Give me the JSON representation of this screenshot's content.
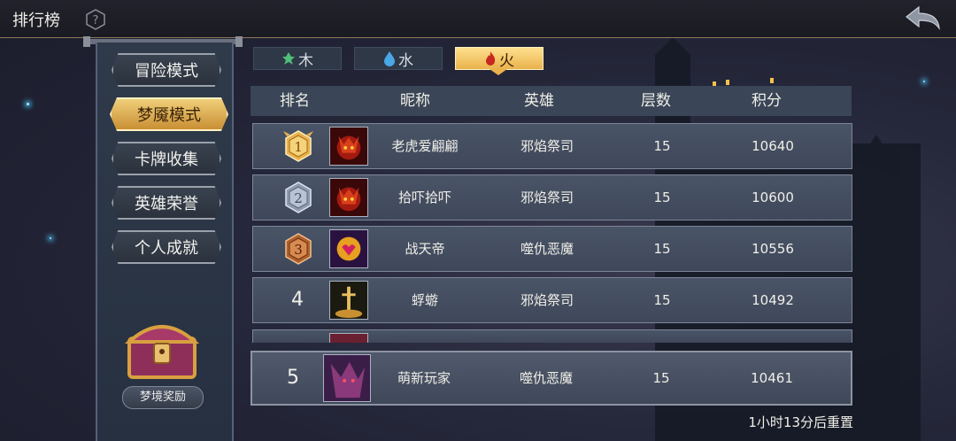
{
  "header": {
    "title": "排行榜"
  },
  "nav": [
    {
      "label": "冒险模式",
      "active": false
    },
    {
      "label": "梦魇模式",
      "active": true
    },
    {
      "label": "卡牌收集",
      "active": false
    },
    {
      "label": "英雄荣誉",
      "active": false
    },
    {
      "label": "个人成就",
      "active": false
    }
  ],
  "reward": {
    "label": "梦境奖励"
  },
  "tabs": [
    {
      "label": "木",
      "icon": "leaf-icon",
      "color": "#4fbf7a"
    },
    {
      "label": "水",
      "icon": "water-drop-icon",
      "color": "#4aa8e8"
    },
    {
      "label": "火",
      "icon": "fire-icon",
      "color": "#c8281e",
      "active": true
    }
  ],
  "table": {
    "columns": [
      "排名",
      "昵称",
      "英雄",
      "层数",
      "积分"
    ],
    "rows": [
      {
        "rank": "1",
        "name": "老虎爱翩翩",
        "hero": "邪焰祭司",
        "floors": "15",
        "score": "10640"
      },
      {
        "rank": "2",
        "name": "拾吓拾吓",
        "hero": "邪焰祭司",
        "floors": "15",
        "score": "10600"
      },
      {
        "rank": "3",
        "name": "战天帝",
        "hero": "噬仇恶魔",
        "floors": "15",
        "score": "10556"
      },
      {
        "rank": "4",
        "name": "蜉蝣",
        "hero": "邪焰祭司",
        "floors": "15",
        "score": "10492"
      }
    ]
  },
  "my_rank": {
    "rank": "5",
    "name": "萌新玩家",
    "hero": "噬仇恶魔",
    "floors": "15",
    "score": "10461"
  },
  "footer": {
    "reset_text": "1小时13分后重置"
  },
  "colors": {
    "gold": "#e9b24c",
    "silver": "#aeb8c8",
    "bronze": "#c8703a"
  }
}
